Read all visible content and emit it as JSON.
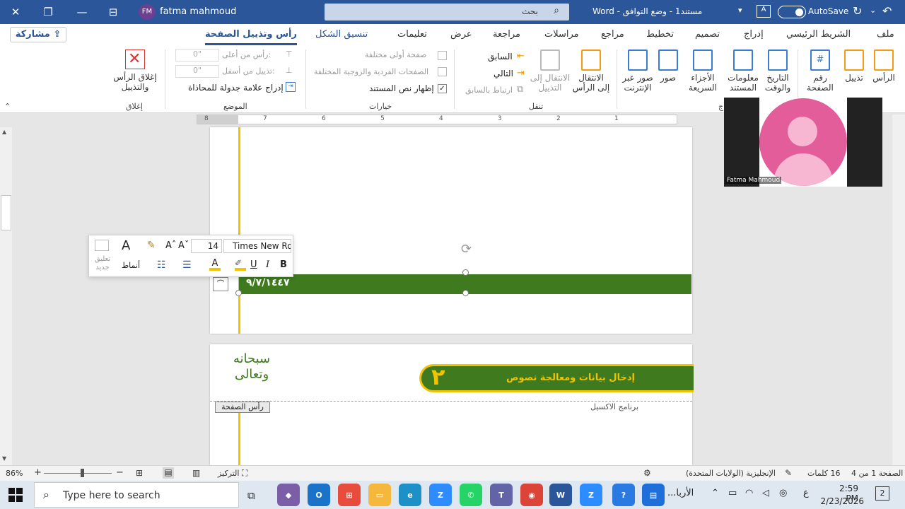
{
  "titlebar": {
    "user_name": "fatma mahmoud",
    "user_initials": "FM",
    "search_placeholder": "بحث",
    "doc_title": "مستند1 - وضع التوافق - Word",
    "autosave_label": "AutoSave",
    "colors": {
      "bar": "#2b579a"
    }
  },
  "tabs": {
    "share": "مشاركة",
    "items": [
      "رأس وتذييل الصفحة",
      "تنسيق الشكل",
      "تعليمات",
      "عرض",
      "مراجعة",
      "مراسلات",
      "مراجع",
      "تخطيط",
      "تصميم",
      "إدراج",
      "الشريط الرئيسي",
      "ملف"
    ]
  },
  "ribbon": {
    "close_btn": "إغلاق الرأس والتذييل",
    "grp_close": "إغلاق",
    "header_from_top": "رأس من أعلى:",
    "header_from_top_val": "0\"",
    "footer_from_bottom": "تذييل من أسفل:",
    "footer_from_bottom_val": "0\"",
    "insert_align_tab": "إدراج علامة جدولة للمحاذاة",
    "grp_position": "الموضع",
    "opt_diff_first": "صفحة أولى مختلفة",
    "opt_diff_oddeven": "الصفحات الفردية والزوجية المختلفة",
    "opt_show_text": "إظهار نص المستند",
    "grp_options": "خيارات",
    "nav_prev": "السابق",
    "nav_next": "التالي",
    "nav_link": "ارتباط بالسابق",
    "goto_footer": "الانتقال إلى التذييل",
    "goto_header": "الانتقال إلى الرأس",
    "grp_nav": "تنقل",
    "online_pics": "صور عبر الإنترنت",
    "pictures": "صور",
    "quick_parts": "الأجزاء السريعة",
    "doc_info": "معلومات المستند",
    "date_time": "التاريخ والوقت",
    "page_number": "رقم الصفحة",
    "footer": "تذييل",
    "header": "الرأس",
    "grp_insert": "إدراج"
  },
  "ruler_ticks": [
    "8",
    "7",
    "6",
    "5",
    "4",
    "3",
    "2",
    "1"
  ],
  "mini_toolbar": {
    "font_name": "Times New Rom",
    "font_size": "14",
    "styles_label": "أنماط",
    "new_comment": "تعليق جديد",
    "bold": "B",
    "italic": "I",
    "underline": "U",
    "font_color_letter": "A"
  },
  "document": {
    "date_text": "٩/٧/١٤٤٧",
    "banner_title": "إدخال بيانات ومعالجة نصوص",
    "banner_number": "٢",
    "program_label": "برنامج الاكسيل",
    "header_tag": "رأس الصفحة",
    "calligraphy": "سبحانه وتعالى",
    "colors": {
      "green": "#3f7a1f",
      "yellow": "#f2c300"
    }
  },
  "video": {
    "name": "Fatma Mahmoud"
  },
  "status": {
    "page": "الصفحة 1 من 4",
    "words": "16 كلمات",
    "language": "الإنجليزية (الولايات المتحدة)",
    "focus": "التركيز",
    "zoom": "86%"
  },
  "taskbar": {
    "search_placeholder": "Type here to search",
    "time": "2:59 PM",
    "date": "2/23/2026",
    "lang": "ع",
    "notif_count": "2",
    "app_label": "الأربا..."
  }
}
